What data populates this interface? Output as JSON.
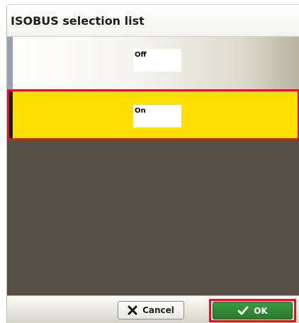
{
  "dialog": {
    "title": "ISOBUS selection list"
  },
  "list": {
    "items": [
      {
        "label": "Off",
        "selected": false
      },
      {
        "label": "On",
        "selected": true
      }
    ]
  },
  "buttons": {
    "cancel_label": "Cancel",
    "ok_label": "OK"
  },
  "icons": {
    "cancel": "x-icon",
    "ok": "checkmark-icon"
  },
  "colors": {
    "selected_background": "#fedf00",
    "highlight_outline": "#e0161c",
    "list_background": "#554f48",
    "ok_button": "#2f8a35"
  }
}
